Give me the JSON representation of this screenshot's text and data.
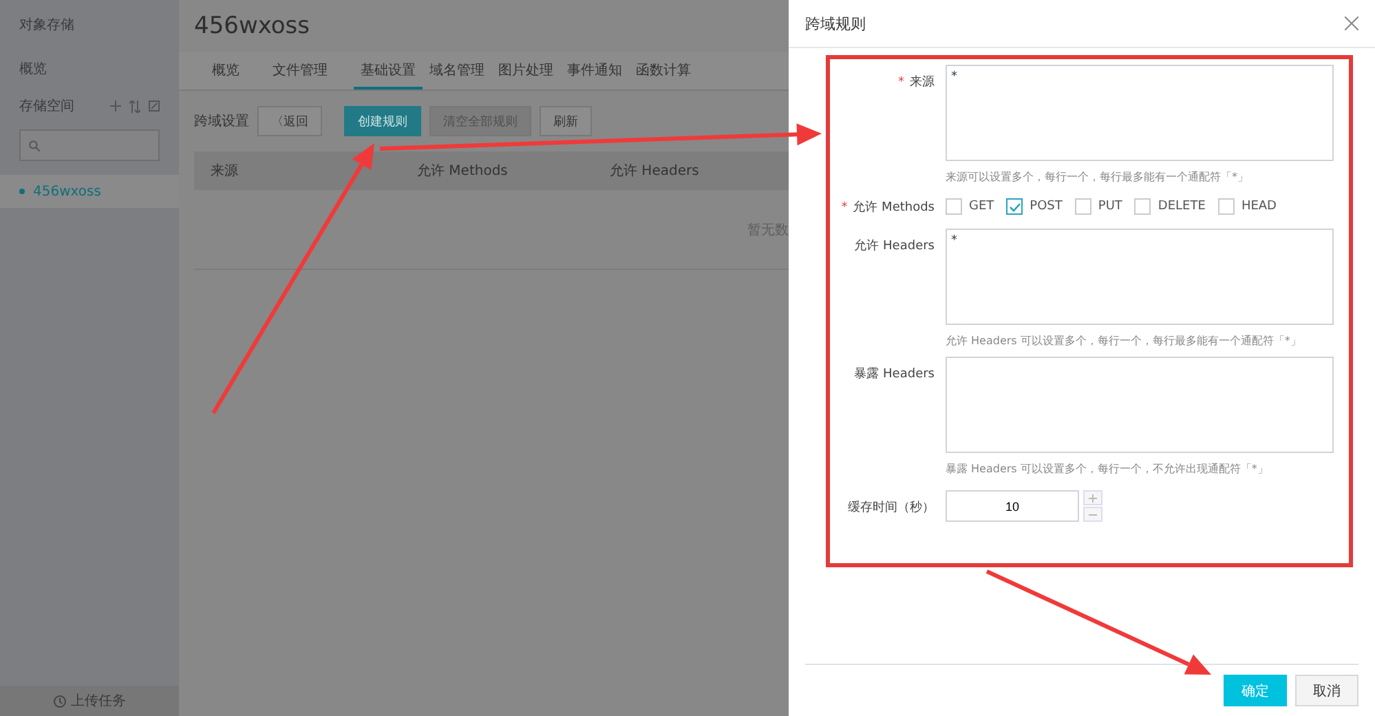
{
  "sidebar": {
    "title": "对象存储",
    "overview": "概览",
    "section": "存储空间",
    "buckets": [
      {
        "name": "456wxoss",
        "selected": true
      }
    ],
    "footer": "上传任务"
  },
  "main": {
    "title": "456wxoss",
    "tabs": [
      {
        "label": "概览",
        "selected": false
      },
      {
        "label": "文件管理",
        "selected": false
      },
      {
        "label": "基础设置",
        "selected": true
      },
      {
        "label": "域名管理",
        "selected": false
      },
      {
        "label": "图片处理",
        "selected": false
      },
      {
        "label": "事件通知",
        "selected": false
      },
      {
        "label": "函数计算",
        "selected": false
      }
    ],
    "toolbar": {
      "label": "跨域设置",
      "buttons": [
        {
          "label": "〈返回",
          "kind": "back",
          "disabled": false
        },
        {
          "label": "创建规则",
          "kind": "primary",
          "disabled": false
        },
        {
          "label": "清空全部规则",
          "kind": "plain",
          "disabled": true
        },
        {
          "label": "刷新",
          "kind": "plain",
          "disabled": false
        }
      ]
    },
    "table": {
      "columns": [
        "来源",
        "允许 Methods",
        "允许 Headers"
      ],
      "empty": "暂无数"
    }
  },
  "dialog": {
    "title": "跨域规则",
    "fields": [
      {
        "kind": "textarea",
        "label": "来源",
        "required": true,
        "value": "*",
        "hint": "来源可以设置多个，每行一个，每行最多能有一个通配符「*」"
      },
      {
        "kind": "checkboxes",
        "label": "允许 Methods",
        "required": true,
        "options": [
          {
            "label": "GET",
            "checked": false
          },
          {
            "label": "POST",
            "checked": true
          },
          {
            "label": "PUT",
            "checked": false
          },
          {
            "label": "DELETE",
            "checked": false
          },
          {
            "label": "HEAD",
            "checked": false
          }
        ]
      },
      {
        "kind": "textarea",
        "label": "允许 Headers",
        "required": false,
        "value": "*",
        "hint": "允许 Headers 可以设置多个，每行一个，每行最多能有一个通配符「*」"
      },
      {
        "kind": "textarea",
        "label": "暴露 Headers",
        "required": false,
        "hint": "暴露 Headers 可以设置多个，每行一个，不允许出现通配符「*」"
      },
      {
        "kind": "number",
        "label": "缓存时间（秒）",
        "required": false,
        "value": "10"
      }
    ],
    "buttons": [
      {
        "label": "确定",
        "kind": "primary"
      },
      {
        "label": "取消",
        "kind": "plain"
      }
    ]
  }
}
